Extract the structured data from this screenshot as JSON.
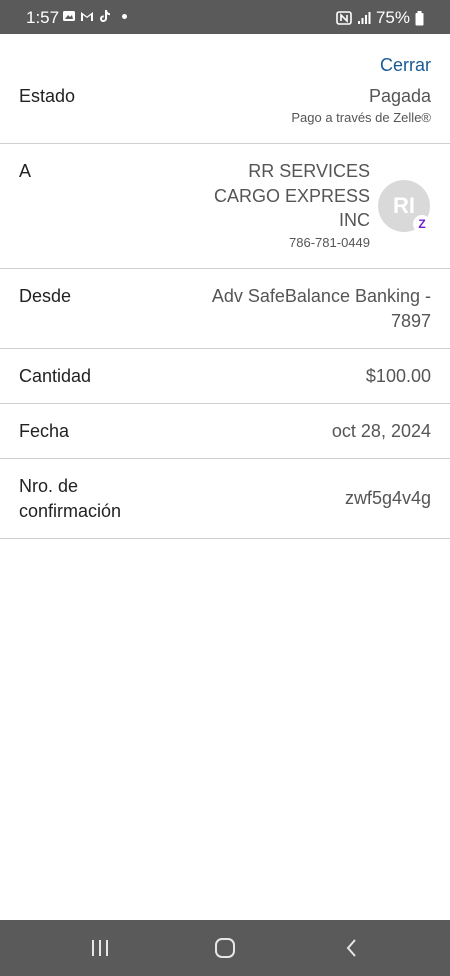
{
  "status_bar": {
    "time": "1:57",
    "battery": "75%",
    "icons": [
      "gallery-icon",
      "gmail-icon",
      "tiktok-icon",
      "notification-dot",
      "nfc-icon",
      "signal-icon",
      "battery-icon"
    ]
  },
  "header": {
    "close_label": "Cerrar"
  },
  "details": {
    "estado": {
      "label": "Estado",
      "value": "Pagada",
      "sub": "Pago a través de Zelle®"
    },
    "a": {
      "label": "A",
      "recipient_lines": [
        "RR SERVICES",
        "CARGO EXPRESS",
        "INC"
      ],
      "phone": "786-781-0449",
      "avatar_initials": "RI",
      "badge": "Z"
    },
    "desde": {
      "label": "Desde",
      "value_lines": [
        "Adv SafeBalance Banking -",
        "7897"
      ]
    },
    "cantidad": {
      "label": "Cantidad",
      "value": "$100.00"
    },
    "fecha": {
      "label": "Fecha",
      "value": "oct 28, 2024"
    },
    "confirmacion": {
      "label_lines": [
        "Nro. de",
        "confirmación"
      ],
      "value": "zwf5g4v4g"
    }
  },
  "colors": {
    "accent": "#1a5a96",
    "zelle": "#6d1ed4",
    "bars": "#5a5a5a"
  },
  "nav": {
    "buttons": [
      "recent-apps-icon",
      "home-icon",
      "back-icon"
    ]
  }
}
